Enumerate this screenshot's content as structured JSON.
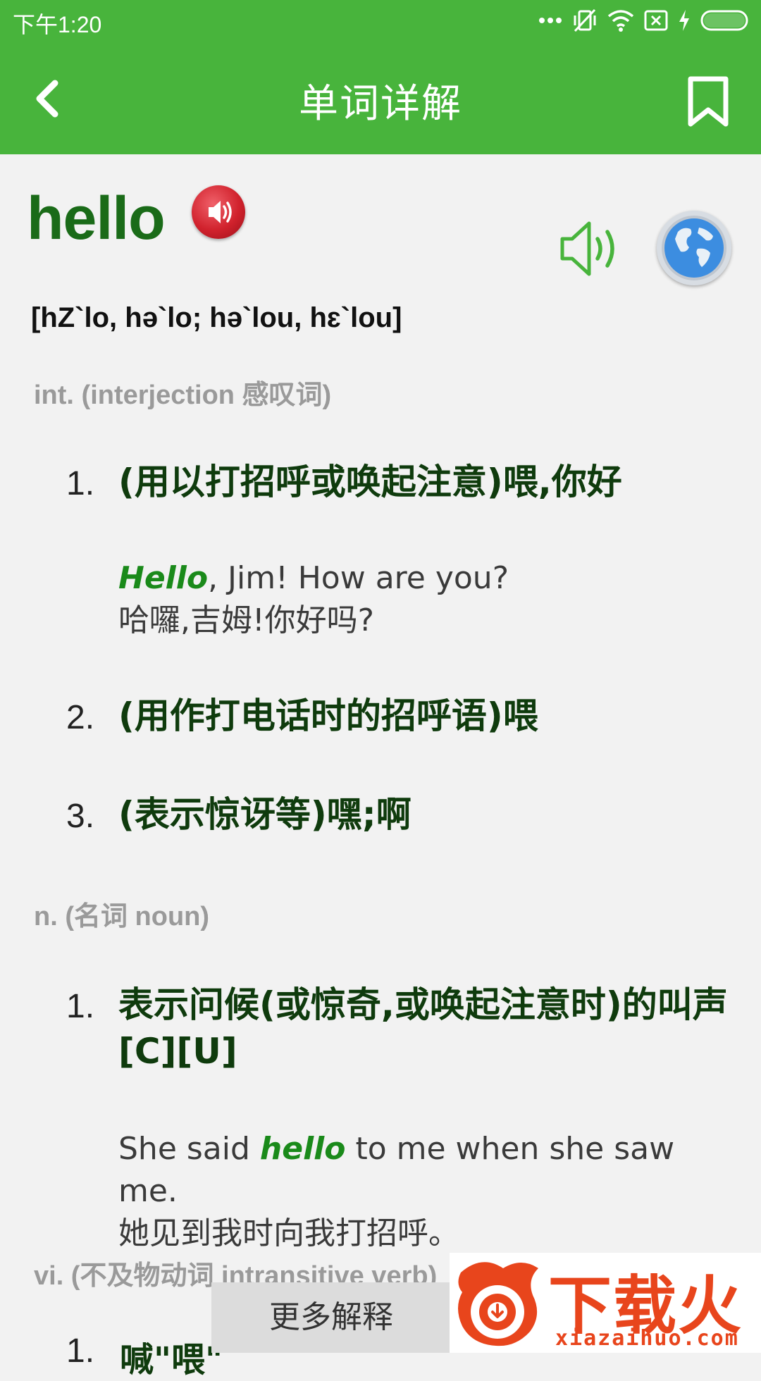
{
  "status_bar": {
    "time": "下午1:20",
    "icons": [
      "more-dots-icon",
      "vibrate-off-icon",
      "wifi-icon",
      "sim-off-icon",
      "charging-icon",
      "battery-icon"
    ]
  },
  "app_bar": {
    "title": "单词详解",
    "back_icon": "back-arrow-icon",
    "bookmark_icon": "bookmark-icon"
  },
  "word": {
    "headword": "hello",
    "phonetic": "[hZ`lo, hə`lo; hə`lou, hɛ`lou]"
  },
  "sections": [
    {
      "pos": "int. (interjection 感叹词)",
      "definitions": [
        {
          "number": "1.",
          "text": "(用以打招呼或唤起注意)喂,你好",
          "example": {
            "en_before": "",
            "en_keyword": "Hello",
            "en_after": ", Jim! How are you?",
            "zh": "哈囉,吉姆!你好吗?"
          }
        },
        {
          "number": "2.",
          "text": "(用作打电话时的招呼语)喂"
        },
        {
          "number": "3.",
          "text": "(表示惊讶等)嘿;啊"
        }
      ]
    },
    {
      "pos": "n. (名词 noun)",
      "definitions": [
        {
          "number": "1.",
          "text": "表示问候(或惊奇,或唤起注意时)的叫声[C][U]",
          "example": {
            "en_before": "She said ",
            "en_keyword": "hello",
            "en_after": " to me when she saw me.",
            "zh": "她见到我时向我打招呼。"
          }
        }
      ]
    },
    {
      "pos": "vi. (不及物动词 intransitive verb)",
      "definitions": [
        {
          "number": "1.",
          "text": "喊\"喂\""
        }
      ]
    }
  ],
  "more_button": {
    "label": "更多解释"
  },
  "watermark": {
    "text": "下载火",
    "url": "xiazaihuo.com"
  },
  "colors": {
    "primary_green": "#48b43c",
    "headword_green": "#1a6b18",
    "keyword_green": "#1a8a1a",
    "watermark_orange": "#e8451c"
  }
}
